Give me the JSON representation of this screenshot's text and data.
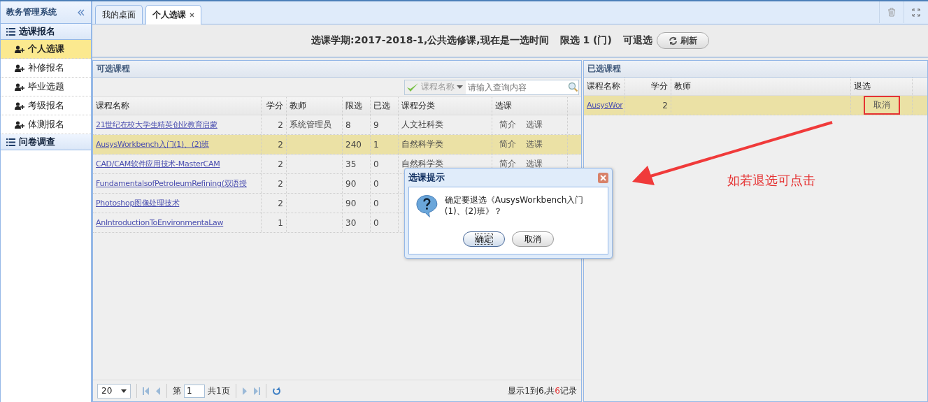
{
  "sidebar": {
    "title": "教务管理系统",
    "sections": [
      {
        "label": "选课报名",
        "items": [
          {
            "label": "个人选课",
            "selected": true
          },
          {
            "label": "补修报名",
            "selected": false
          },
          {
            "label": "毕业选题",
            "selected": false
          },
          {
            "label": "考级报名",
            "selected": false
          },
          {
            "label": "体测报名",
            "selected": false
          }
        ]
      },
      {
        "label": "问卷调查"
      }
    ]
  },
  "tabs": [
    {
      "label": "我的桌面",
      "selected": false,
      "closable": false
    },
    {
      "label": "个人选课",
      "selected": true,
      "closable": true
    }
  ],
  "info_bar": {
    "term": "选课学期:2017-2018-1,公共选修课,现在是一选时间",
    "limit": "限选 1 (门)",
    "withdraw": "可退选",
    "refresh_button": "刷新"
  },
  "available": {
    "title": "可选课程",
    "search": {
      "filter": "课程名称",
      "placeholder": "请输入查询内容"
    },
    "columns": [
      "课程名称",
      "学分",
      "教师",
      "限选",
      "已选",
      "课程分类",
      "选课"
    ],
    "rows": [
      {
        "name": "21世纪在校大学生精英创业教育启蒙",
        "credits": "2",
        "teacher": "系统管理员",
        "limit": "8",
        "enrolled": "9",
        "category": "人文社科类",
        "actions": [
          "简介",
          "选课"
        ],
        "selected": false
      },
      {
        "name": "AusysWorkbench入门(1)、(2)班",
        "credits": "2",
        "teacher": "",
        "limit": "240",
        "enrolled": "1",
        "category": "自然科学类",
        "actions": [
          "简介",
          "选课"
        ],
        "selected": true
      },
      {
        "name": "CAD/CAM软件应用技术-MasterCAM",
        "credits": "2",
        "teacher": "",
        "limit": "35",
        "enrolled": "0",
        "category": "自然科学类",
        "actions": [
          "简介",
          "选课"
        ],
        "selected": false
      },
      {
        "name": "FundamentalsofPetroleumRefining(双语授",
        "credits": "2",
        "teacher": "",
        "limit": "90",
        "enrolled": "0",
        "selected": false
      },
      {
        "name": "Photoshop图像处理技术",
        "credits": "2",
        "teacher": "",
        "limit": "90",
        "enrolled": "0",
        "selected": false
      },
      {
        "name": "AnIntroductionToEnvironmentaLaw",
        "credits": "1",
        "teacher": "",
        "limit": "30",
        "enrolled": "0",
        "selected": false
      }
    ],
    "pager": {
      "page_size": "20",
      "page_prefix": "第",
      "page": "1",
      "total_pages": "共1页",
      "summary_prefix": "显示1到6,共",
      "count": "6",
      "summary_suffix": "记录"
    }
  },
  "chosen": {
    "title": "已选课程",
    "columns": [
      "课程名称",
      "学分",
      "教师",
      "退选"
    ],
    "rows": [
      {
        "name": "AusysWor",
        "credits": "2",
        "teacher": "",
        "action": "取消",
        "selected": true,
        "highlighted": true
      }
    ]
  },
  "dialog": {
    "title": "选课提示",
    "message": "确定要退选《AusysWorkbench入门(1)、(2)班》？",
    "buttons": [
      {
        "label": "确定",
        "focused": true
      },
      {
        "label": "取消",
        "focused": false
      }
    ]
  },
  "annotation": {
    "text": "如若退选可点击"
  }
}
